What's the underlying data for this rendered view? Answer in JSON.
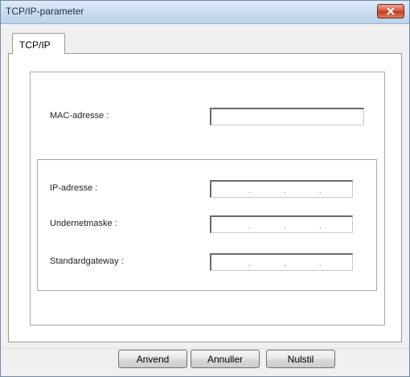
{
  "window": {
    "title": "TCP/IP-parameter"
  },
  "tabs": [
    {
      "label": "TCP/IP"
    }
  ],
  "fields": {
    "mac_label": "MAC-adresse :",
    "mac_value": "",
    "ip_label": "IP-adresse :",
    "subnet_label": "Undernetmaske :",
    "gateway_label": "Standardgateway :"
  },
  "ip_separator": ".",
  "buttons": {
    "apply": "Anvend",
    "cancel": "Annuller",
    "reset": "Nulstil"
  },
  "icons": {
    "close": "close-icon"
  },
  "colors": {
    "close_button": "#c33b24",
    "title_bar": "#c9dbee"
  }
}
